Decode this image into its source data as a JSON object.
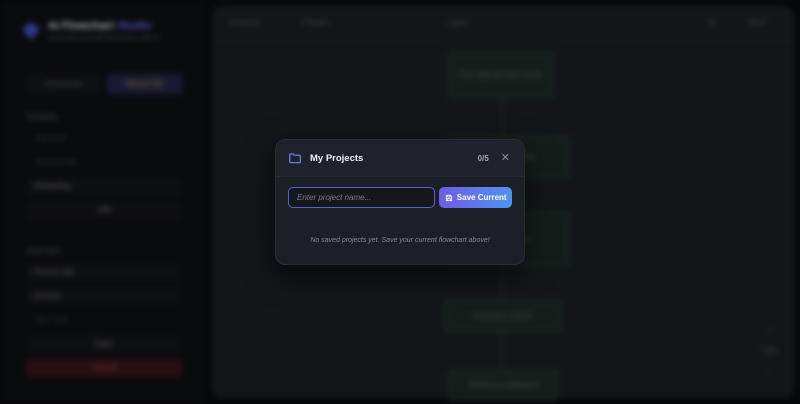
{
  "background": {
    "brand_title": "AI Flowchart",
    "brand_title_accent": "Studio",
    "brand_subtitle": "Generate and edit flowcharts with AI",
    "mode_tabs": [
      "AI Generate",
      "Manual Edit"
    ],
    "sections": [
      {
        "heading": "Templates",
        "items": [
          "Login flow",
          "Checkout flow",
          "Onboarding"
        ],
        "action": "Add"
      },
      {
        "heading": "Node types",
        "items": [
          "Process step",
          "Decision",
          "Start / End"
        ],
        "actions": [
          "Export",
          "Clear All"
        ]
      }
    ],
    "toolbar": {
      "left": "Flowchart",
      "middle": "5 Nodes",
      "center": "Layout",
      "right1": "Fit",
      "right2": "Reset"
    },
    "nodes": [
      "User visits the login screen",
      "Enter credentials",
      "Validate input",
      "Account is created",
      "Redirect to dashboard"
    ],
    "zoom": {
      "in": "+",
      "level": "100",
      "out": "−"
    }
  },
  "modal": {
    "title": "My Projects",
    "count": "0/5",
    "close": "✕",
    "input_placeholder": "Enter project name...",
    "input_value": "",
    "save_label": "Save Current",
    "empty_message": "No saved projects yet. Save your current flowchart above!"
  },
  "colors": {
    "accent": "#5b5fd6",
    "save_gradient_start": "#6d5ce8",
    "save_gradient_end": "#4f93f0",
    "modal_bg": "#1d1f27",
    "overlay": "#000000"
  }
}
